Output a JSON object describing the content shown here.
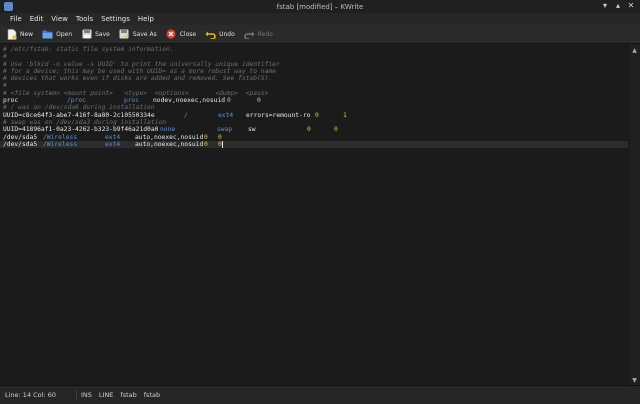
{
  "window": {
    "title": "fstab [modified] – KWrite"
  },
  "menu": [
    "File",
    "Edit",
    "View",
    "Tools",
    "Settings",
    "Help"
  ],
  "toolbar": [
    {
      "label": "New",
      "icon": "new-document-icon",
      "enabled": true
    },
    {
      "label": "Open",
      "icon": "open-folder-icon",
      "enabled": true
    },
    {
      "label": "Save",
      "icon": "save-icon",
      "enabled": true
    },
    {
      "label": "Save As",
      "icon": "save-as-icon",
      "enabled": true
    },
    {
      "label": "Close",
      "icon": "close-document-icon",
      "enabled": true
    },
    {
      "label": "Undo",
      "icon": "undo-icon",
      "enabled": true
    },
    {
      "label": "Redo",
      "icon": "redo-icon",
      "enabled": false
    }
  ],
  "editor": {
    "lines": [
      {
        "kind": "comment",
        "text": "# /etc/fstab: static file system information."
      },
      {
        "kind": "comment",
        "text": "#"
      },
      {
        "kind": "comment",
        "text": "# Use 'blkid -o value -s UUID' to print the universally unique identifier"
      },
      {
        "kind": "comment",
        "text": "# for a device; this may be used with UUID= as a more robust way to name"
      },
      {
        "kind": "comment",
        "text": "# devices that works even if disks are added and removed. See fstab(5)."
      },
      {
        "kind": "comment",
        "text": "#"
      },
      {
        "kind": "comment",
        "text": "# <file system> <mount point>   <type>  <options>       <dump>  <pass>"
      },
      {
        "kind": "entry",
        "fields": [
          "proc",
          "/proc",
          "proc",
          "nodev,noexec,nosuid",
          "0",
          "0"
        ]
      },
      {
        "kind": "comment",
        "text": "# / was on /dev/sda6 during installation"
      },
      {
        "kind": "entry",
        "fields": [
          "UUID=c8ce64f3-abe7-416f-8a80-2c10550334e",
          "/",
          "ext4",
          "errors=remount-ro",
          "0",
          "1"
        ]
      },
      {
        "kind": "comment",
        "text": "# swap was on /dev/sda3 during installation"
      },
      {
        "kind": "entry",
        "fields": [
          "UUID=41896af1-0a23-4262-b323-b9f46a21d0a0",
          "none",
          "swap",
          "sw",
          "0",
          "0"
        ]
      },
      {
        "kind": "entry",
        "fields": [
          "/dev/sda5",
          "/Wireless",
          "ext4",
          "auto,noexec,nosuid",
          "0",
          "0"
        ]
      },
      {
        "kind": "entry",
        "fields": [
          "/dev/sda5",
          "/Wireless",
          "ext4",
          "auto,noexec,nosuid",
          "0",
          "0"
        ],
        "current": true
      }
    ]
  },
  "status": {
    "position": "Line: 14 Col: 60",
    "insert_mode": "INS",
    "selection_mode": "LINE",
    "encoding": "fstab",
    "filetype": "fstab"
  }
}
